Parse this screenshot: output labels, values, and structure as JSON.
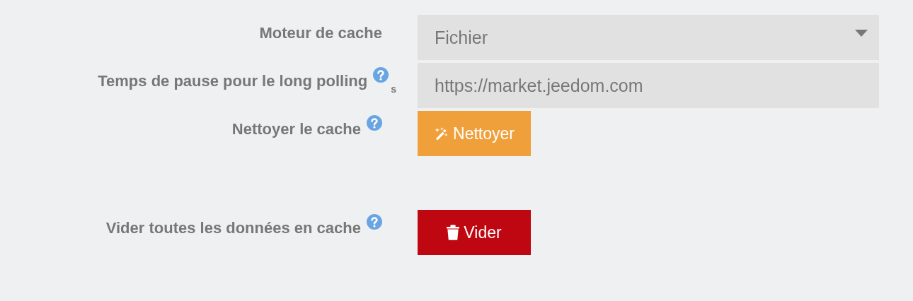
{
  "fields": [
    {
      "kind": "select",
      "label": "Moteur de cache",
      "help": false,
      "value": "Fichier"
    },
    {
      "kind": "input",
      "label": "Temps de pause pour le long polling",
      "help": true,
      "unit": "s",
      "value": "https://market.jeedom.com"
    },
    {
      "kind": "warning_button",
      "label": "Nettoyer le cache",
      "help": true,
      "button": "Nettoyer"
    },
    {
      "kind": "danger_button",
      "label": "Vider toutes les données en cache",
      "help": true,
      "button": "Vider"
    }
  ]
}
